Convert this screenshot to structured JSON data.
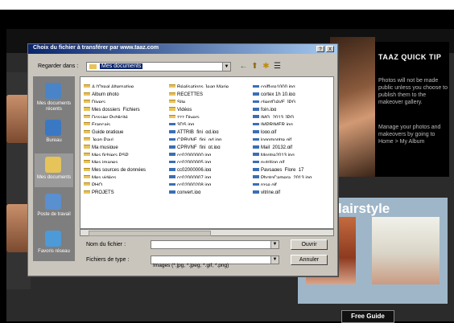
{
  "background": {
    "tip_title": "TAAZ QUICK TIP",
    "tip_paragraphs": [
      "Photos will not be made public unless you choose to publish them to the makeover gallery.",
      "Manage your photos and makeovers by going to Home > My Album"
    ],
    "hair_title": "lairstyle",
    "guide_button": "Free Guide"
  },
  "dialog": {
    "title": "Choix du fichier à transférer par www.taaz.com",
    "help_btn": "?",
    "close_btn": "X",
    "lookin_label": "Regarder dans :",
    "lookin_value": "Mes documents",
    "tools": {
      "back": "←",
      "up": "⬆",
      "newfolder": "✱",
      "views": "☰"
    },
    "places": [
      {
        "label": "Mes documents récents",
        "icon": "recent-docs-icon",
        "color": "#4a84c8"
      },
      {
        "label": "Bureau",
        "icon": "desktop-icon",
        "color": "#3a78c4"
      },
      {
        "label": "Mes documents",
        "icon": "my-documents-icon",
        "color": "#e6c45a"
      },
      {
        "label": "Poste de travail",
        "icon": "my-computer-icon",
        "color": "#5a8fd0"
      },
      {
        "label": "Favoris réseau",
        "icon": "network-icon",
        "color": "#4c9ad8"
      }
    ],
    "files_col1": [
      {
        "name": "A l'Oreal Alternative",
        "type": "folder"
      },
      {
        "name": "Album photo",
        "type": "folder"
      },
      {
        "name": "Divers",
        "type": "folder"
      },
      {
        "name": "Mes dossiers_Fichiers",
        "type": "folder"
      },
      {
        "name": "Dossier Publicité",
        "type": "folder"
      },
      {
        "name": "Français",
        "type": "folder"
      },
      {
        "name": "Guide pratique",
        "type": "folder"
      },
      {
        "name": "Jean Paul",
        "type": "folder"
      },
      {
        "name": "Ma musique",
        "type": "folder"
      },
      {
        "name": "Mes fichiers PSP",
        "type": "folder"
      },
      {
        "name": "Mes images",
        "type": "folder"
      },
      {
        "name": "Mes sources de données",
        "type": "folder"
      },
      {
        "name": "Mes vidéos",
        "type": "folder"
      },
      {
        "name": "PHO",
        "type": "folder"
      },
      {
        "name": "PROJETS",
        "type": "folder"
      }
    ],
    "files_col2": [
      {
        "name": "Réalisations Jean Marie",
        "type": "folder"
      },
      {
        "name": "RECETTES",
        "type": "folder"
      },
      {
        "name": "Site",
        "type": "folder"
      },
      {
        "name": "Vidéos",
        "type": "folder"
      },
      {
        "name": "zzz Divers",
        "type": "folder"
      },
      {
        "name": "3DS.jpg",
        "type": "image"
      },
      {
        "name": "ATTRIB_fini_gd.jpg",
        "type": "image"
      },
      {
        "name": "CPRVNF_fini_gd.jpg",
        "type": "image"
      },
      {
        "name": "CPRVNF_fini_pt.jpg",
        "type": "image"
      },
      {
        "name": "cc02000000.jpg",
        "type": "image"
      },
      {
        "name": "cc02000005.jpg",
        "type": "image"
      },
      {
        "name": "cc02000006.jpg",
        "type": "image"
      },
      {
        "name": "cc02000007.jpg",
        "type": "image"
      },
      {
        "name": "cc02000208.jpg",
        "type": "image"
      },
      {
        "name": "convert.jpg",
        "type": "image"
      }
    ],
    "files_col3": [
      {
        "name": "coiffure1000.jpg",
        "type": "image"
      },
      {
        "name": "cortex 1h 10.jpg",
        "type": "image"
      },
      {
        "name": "clientDAVE.JPG",
        "type": "image"
      },
      {
        "name": "foin.jpg",
        "type": "image"
      },
      {
        "name": "IMG_2013.JPG",
        "type": "image"
      },
      {
        "name": "IMPRIMER.jpg",
        "type": "image"
      },
      {
        "name": "logo.gif",
        "type": "image"
      },
      {
        "name": "logomontre.gif",
        "type": "image"
      },
      {
        "name": "Mail_20132.gif",
        "type": "image"
      },
      {
        "name": "Montre2013.jpg",
        "type": "image"
      },
      {
        "name": "nutrition.gif",
        "type": "image"
      },
      {
        "name": "Paysages_Flore_17",
        "type": "image"
      },
      {
        "name": "PhotoCamera_2013.jpg",
        "type": "image"
      },
      {
        "name": "rose.gif",
        "type": "image"
      },
      {
        "name": "vitrine.gif",
        "type": "image"
      }
    ],
    "filename_label": "Nom du fichier :",
    "filename_value": "",
    "filetype_label": "Fichiers de type :",
    "filetype_value": "Images (*.jpg, *.jpeg, *.gif, *.png)",
    "open_btn": "Ouvrir",
    "cancel_btn": "Annuler"
  }
}
